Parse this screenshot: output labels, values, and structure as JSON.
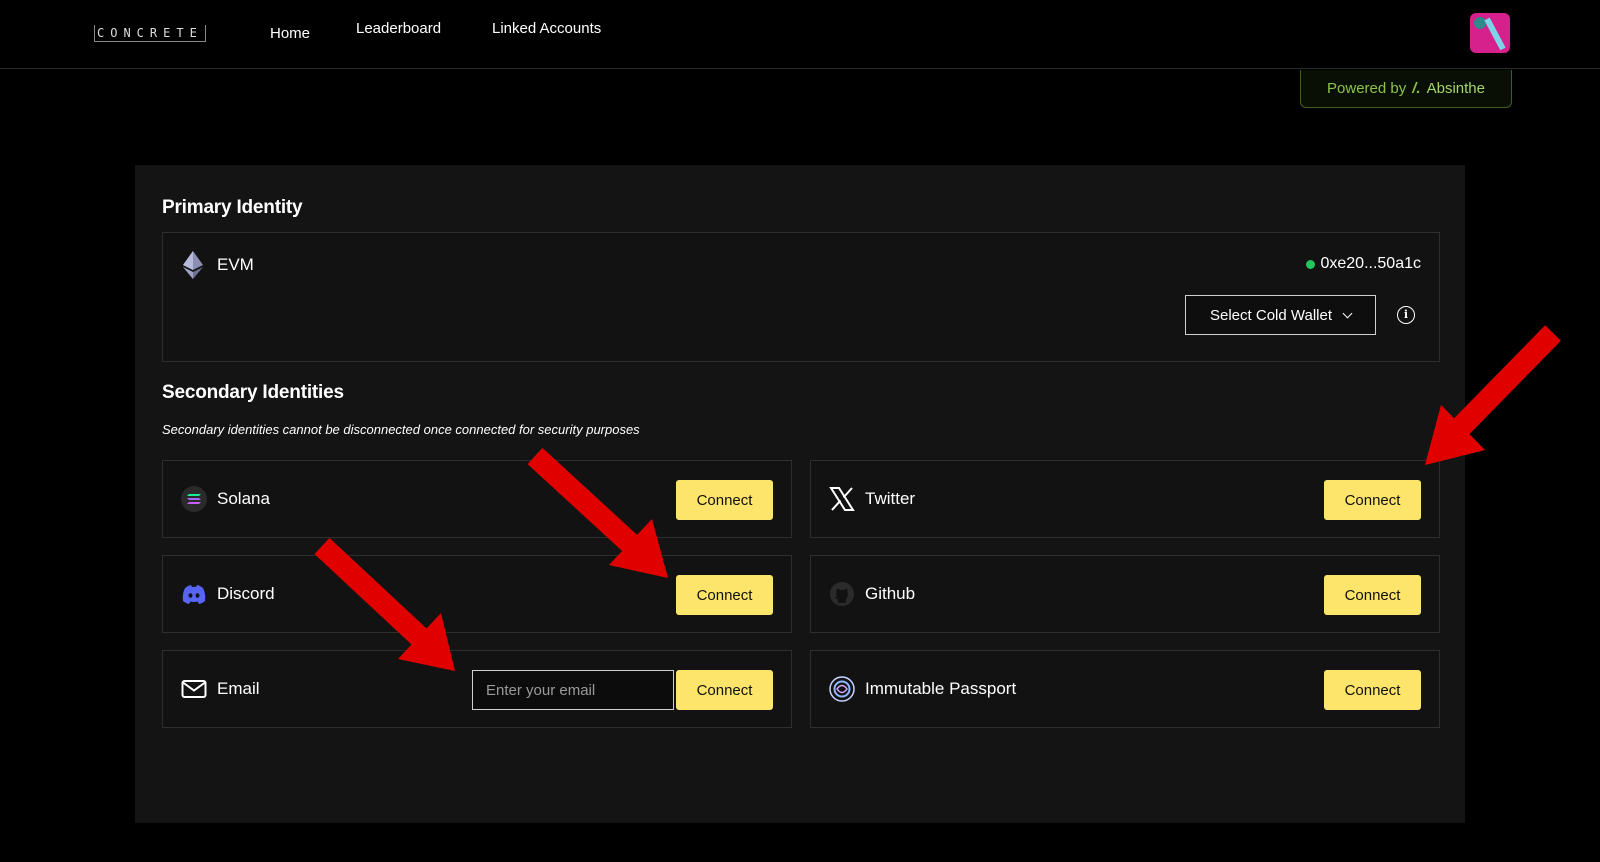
{
  "header": {
    "logo": "CONCRETE",
    "nav": [
      "Home",
      "Leaderboard",
      "Linked Accounts"
    ],
    "powered_prefix": "Powered by",
    "powered_brand": "Absinthe"
  },
  "primary": {
    "title": "Primary Identity",
    "chain": "EVM",
    "address": "0xe20...50a1c",
    "select_label": "Select Cold Wallet"
  },
  "secondary": {
    "title": "Secondary Identities",
    "note": "Secondary identities cannot be disconnected once connected for security purposes",
    "connect_label": "Connect",
    "email_placeholder": "Enter your email",
    "items": [
      {
        "label": "Solana",
        "icon": "solana-icon"
      },
      {
        "label": "Twitter",
        "icon": "x-icon"
      },
      {
        "label": "Discord",
        "icon": "discord-icon"
      },
      {
        "label": "Github",
        "icon": "github-icon"
      },
      {
        "label": "Email",
        "icon": "mail-icon"
      },
      {
        "label": "Immutable Passport",
        "icon": "immutable-passport-icon"
      }
    ]
  },
  "colors": {
    "accent_button": "#fde56c",
    "status_green": "#22c55e",
    "annotation_arrow": "#e00000"
  }
}
